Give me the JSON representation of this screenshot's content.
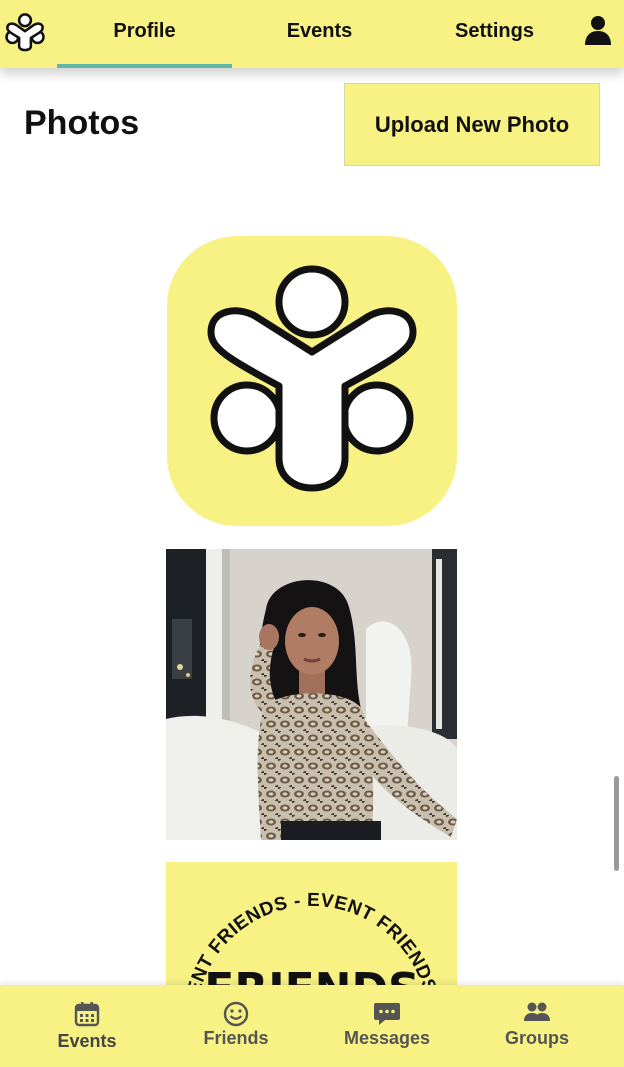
{
  "nav": {
    "logo_icon": "app-logo-icon",
    "tabs": [
      {
        "label": "Profile",
        "active": true
      },
      {
        "label": "Events",
        "active": false
      },
      {
        "label": "Settings",
        "active": false
      }
    ],
    "account_icon": "person-icon"
  },
  "header": {
    "title": "Photos",
    "upload_label": "Upload New Photo"
  },
  "photos": [
    {
      "kind": "app-logo"
    },
    {
      "kind": "portrait-photo"
    },
    {
      "kind": "badge",
      "ring_text": "EVENT FRIENDS - EVENT FRIENDS - EVENT FRIENDS - EVENT",
      "center_text": "FRIENDS"
    }
  ],
  "bottom_nav": [
    {
      "label": "Events",
      "icon": "calendar-icon"
    },
    {
      "label": "Friends",
      "icon": "smiley-icon"
    },
    {
      "label": "Messages",
      "icon": "chat-bubble-icon"
    },
    {
      "label": "Groups",
      "icon": "group-icon"
    }
  ],
  "colors": {
    "brand_yellow": "#f7f283",
    "tab_indicator": "#5fb6a6",
    "text_dark": "#111111",
    "bottom_label": "#555555"
  }
}
